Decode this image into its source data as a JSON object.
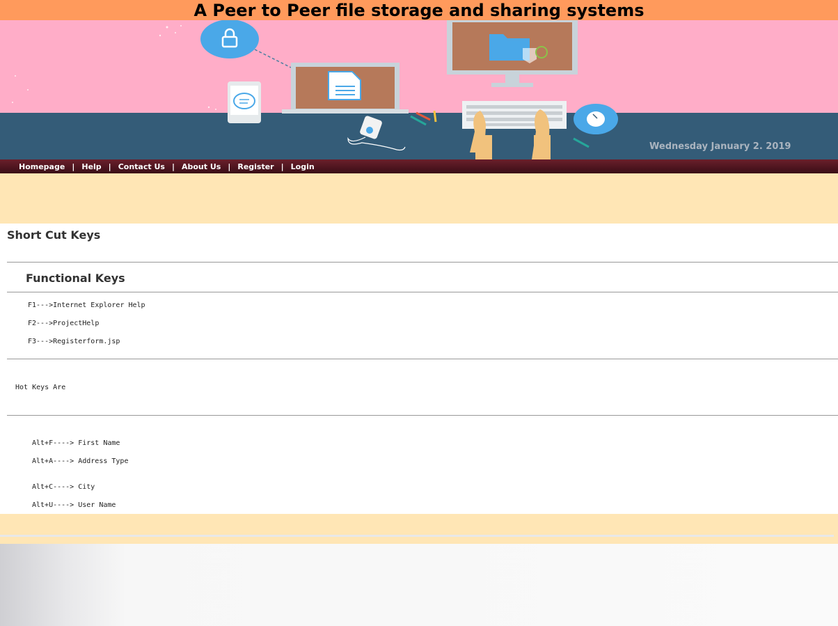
{
  "header": {
    "title": "A Peer to Peer file storage and sharing systems"
  },
  "banner": {
    "date": "Wednesday January 2. 2019"
  },
  "nav": {
    "items": [
      "Homepage",
      "Help",
      "Contact Us",
      "About Us",
      "Register",
      "Login"
    ],
    "separator": "|"
  },
  "content": {
    "heading": "Short Cut Keys",
    "functional_heading": "Functional Keys",
    "functional_keys": [
      "F1--->Internet Explorer Help",
      "F2--->ProjectHelp",
      "F3--->Registerform.jsp"
    ],
    "hot_keys_label": "Hot Keys Are",
    "hot_keys": [
      "Alt+F----> First Name",
      "Alt+A----> Address Type",
      "Alt+C----> City",
      "Alt+U----> User Name"
    ]
  },
  "colors": {
    "title_bar": "#ff9a5c",
    "banner_sky": "#ffadc8",
    "banner_desk": "#345c78",
    "nav_bg": "#4e1520",
    "band": "#ffe6b5"
  },
  "icons": [
    "lock-icon",
    "document-icon",
    "folder-icon",
    "chat-icon",
    "mouse-icon",
    "music-player-icon",
    "keyboard-icon"
  ]
}
